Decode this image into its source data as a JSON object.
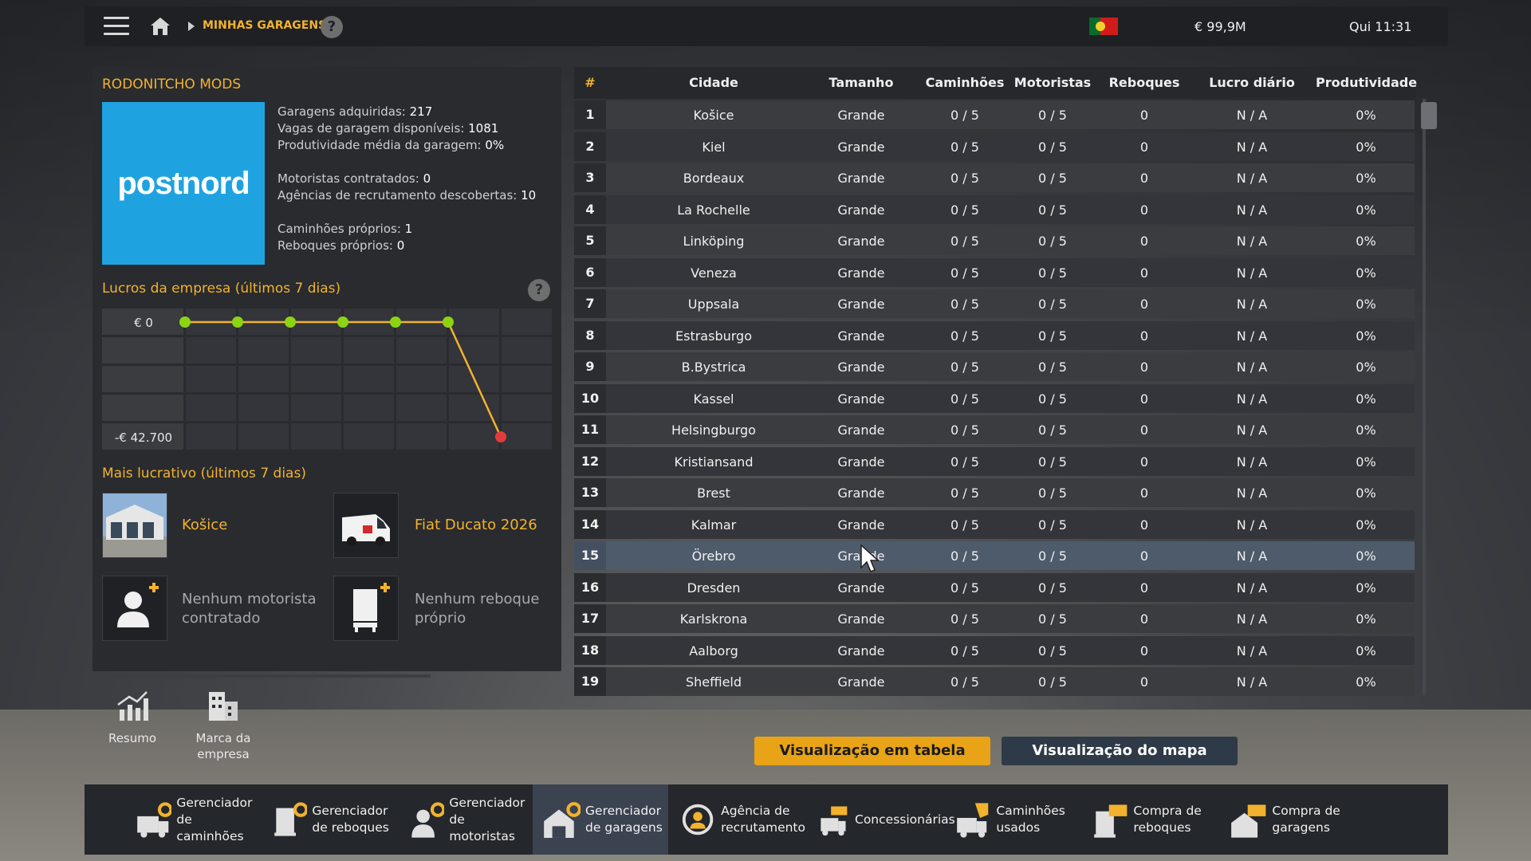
{
  "topbar": {
    "breadcrumb": "MINHAS GARAGENS",
    "help": "?",
    "money": "€ 99,9M",
    "clock": "Qui 11:31"
  },
  "company": {
    "name": "RODONITCHO MODS",
    "logo_text": "postnord",
    "stats": {
      "garages_label": "Garagens adquiridas:",
      "garages_value": "217",
      "slots_label": "Vagas de garagem disponíveis:",
      "slots_value": "1081",
      "prod_label": "Produtividade média da garagem:",
      "prod_value": "0%",
      "drivers_label": "Motoristas contratados:",
      "drivers_value": "0",
      "agencies_label": "Agências de recrutamento descobertas:",
      "agencies_value": "10",
      "trucks_label": "Caminhões próprios:",
      "trucks_value": "1",
      "trailers_label": "Reboques próprios:",
      "trailers_value": "0"
    }
  },
  "profits": {
    "title": "Lucros da empresa (últimos 7 dias)",
    "help": "?",
    "chart_data": {
      "type": "line",
      "title": "Lucros da empresa (últimos 7 dias)",
      "y_tick_labels": [
        "€ 0",
        "-€ 42.700"
      ],
      "ylim": [
        -42700,
        0
      ],
      "x": [
        1,
        2,
        3,
        4,
        5,
        6,
        7
      ],
      "values": [
        0,
        0,
        0,
        0,
        0,
        0,
        -42700
      ],
      "colors": {
        "line": "#f2b22e",
        "point": "#8cd312",
        "last_point": "#e23b3b"
      },
      "grid": true
    }
  },
  "most_profitable": {
    "title": "Mais lucrativo (últimos 7 dias)",
    "garage": "Košice",
    "truck": "Fiat Ducato 2026",
    "no_driver": "Nenhum motorista contratado",
    "no_trailer": "Nenhum reboque próprio"
  },
  "left_tabs": {
    "summary": "Resumo",
    "brand": "Marca da empresa"
  },
  "table": {
    "headers": [
      "#",
      "Cidade",
      "Tamanho",
      "Caminhões",
      "Motoristas",
      "Reboques",
      "Lucro diário",
      "Produtividade"
    ],
    "selected_row": 15,
    "rows": [
      {
        "n": "1",
        "city": "Košice",
        "size": "Grande",
        "trucks": "0 / 5",
        "drivers": "0 / 5",
        "trailers": "0",
        "profit": "N / A",
        "prod": "0%"
      },
      {
        "n": "2",
        "city": "Kiel",
        "size": "Grande",
        "trucks": "0 / 5",
        "drivers": "0 / 5",
        "trailers": "0",
        "profit": "N / A",
        "prod": "0%"
      },
      {
        "n": "3",
        "city": "Bordeaux",
        "size": "Grande",
        "trucks": "0 / 5",
        "drivers": "0 / 5",
        "trailers": "0",
        "profit": "N / A",
        "prod": "0%"
      },
      {
        "n": "4",
        "city": "La Rochelle",
        "size": "Grande",
        "trucks": "0 / 5",
        "drivers": "0 / 5",
        "trailers": "0",
        "profit": "N / A",
        "prod": "0%"
      },
      {
        "n": "5",
        "city": "Linköping",
        "size": "Grande",
        "trucks": "0 / 5",
        "drivers": "0 / 5",
        "trailers": "0",
        "profit": "N / A",
        "prod": "0%"
      },
      {
        "n": "6",
        "city": "Veneza",
        "size": "Grande",
        "trucks": "0 / 5",
        "drivers": "0 / 5",
        "trailers": "0",
        "profit": "N / A",
        "prod": "0%"
      },
      {
        "n": "7",
        "city": "Uppsala",
        "size": "Grande",
        "trucks": "0 / 5",
        "drivers": "0 / 5",
        "trailers": "0",
        "profit": "N / A",
        "prod": "0%"
      },
      {
        "n": "8",
        "city": "Estrasburgo",
        "size": "Grande",
        "trucks": "0 / 5",
        "drivers": "0 / 5",
        "trailers": "0",
        "profit": "N / A",
        "prod": "0%"
      },
      {
        "n": "9",
        "city": "B.Bystrica",
        "size": "Grande",
        "trucks": "0 / 5",
        "drivers": "0 / 5",
        "trailers": "0",
        "profit": "N / A",
        "prod": "0%"
      },
      {
        "n": "10",
        "city": "Kassel",
        "size": "Grande",
        "trucks": "0 / 5",
        "drivers": "0 / 5",
        "trailers": "0",
        "profit": "N / A",
        "prod": "0%"
      },
      {
        "n": "11",
        "city": "Helsingburgo",
        "size": "Grande",
        "trucks": "0 / 5",
        "drivers": "0 / 5",
        "trailers": "0",
        "profit": "N / A",
        "prod": "0%"
      },
      {
        "n": "12",
        "city": "Kristiansand",
        "size": "Grande",
        "trucks": "0 / 5",
        "drivers": "0 / 5",
        "trailers": "0",
        "profit": "N / A",
        "prod": "0%"
      },
      {
        "n": "13",
        "city": "Brest",
        "size": "Grande",
        "trucks": "0 / 5",
        "drivers": "0 / 5",
        "trailers": "0",
        "profit": "N / A",
        "prod": "0%"
      },
      {
        "n": "14",
        "city": "Kalmar",
        "size": "Grande",
        "trucks": "0 / 5",
        "drivers": "0 / 5",
        "trailers": "0",
        "profit": "N / A",
        "prod": "0%"
      },
      {
        "n": "15",
        "city": "Örebro",
        "size": "Grande",
        "trucks": "0 / 5",
        "drivers": "0 / 5",
        "trailers": "0",
        "profit": "N / A",
        "prod": "0%"
      },
      {
        "n": "16",
        "city": "Dresden",
        "size": "Grande",
        "trucks": "0 / 5",
        "drivers": "0 / 5",
        "trailers": "0",
        "profit": "N / A",
        "prod": "0%"
      },
      {
        "n": "17",
        "city": "Karlskrona",
        "size": "Grande",
        "trucks": "0 / 5",
        "drivers": "0 / 5",
        "trailers": "0",
        "profit": "N / A",
        "prod": "0%"
      },
      {
        "n": "18",
        "city": "Aalborg",
        "size": "Grande",
        "trucks": "0 / 5",
        "drivers": "0 / 5",
        "trailers": "0",
        "profit": "N / A",
        "prod": "0%"
      },
      {
        "n": "19",
        "city": "Sheffield",
        "size": "Grande",
        "trucks": "0 / 5",
        "drivers": "0 / 5",
        "trailers": "0",
        "profit": "N / A",
        "prod": "0%"
      }
    ]
  },
  "view_buttons": {
    "table": "Visualização em tabela",
    "map": "Visualização do mapa"
  },
  "dock": [
    {
      "label": "Gerenciador de caminhões",
      "icon": "truck-gear-icon"
    },
    {
      "label": "Gerenciador de reboques",
      "icon": "trailer-gear-icon"
    },
    {
      "label": "Gerenciador de motoristas",
      "icon": "driver-gear-icon"
    },
    {
      "label": "Gerenciador de garagens",
      "icon": "garage-gear-icon"
    },
    {
      "label": "Agência de recrutamento",
      "icon": "recruitment-icon"
    },
    {
      "label": "Concessionárias",
      "icon": "dealer-icon"
    },
    {
      "label": "Caminhões usados",
      "icon": "used-truck-icon"
    },
    {
      "label": "Compra de reboques",
      "icon": "buy-trailer-icon"
    },
    {
      "label": "Compra de garagens",
      "icon": "buy-garage-icon"
    }
  ],
  "theme": {
    "accent": "#f2b22e",
    "panel": "#292b2f",
    "logo_bg": "#1fa3e0"
  }
}
